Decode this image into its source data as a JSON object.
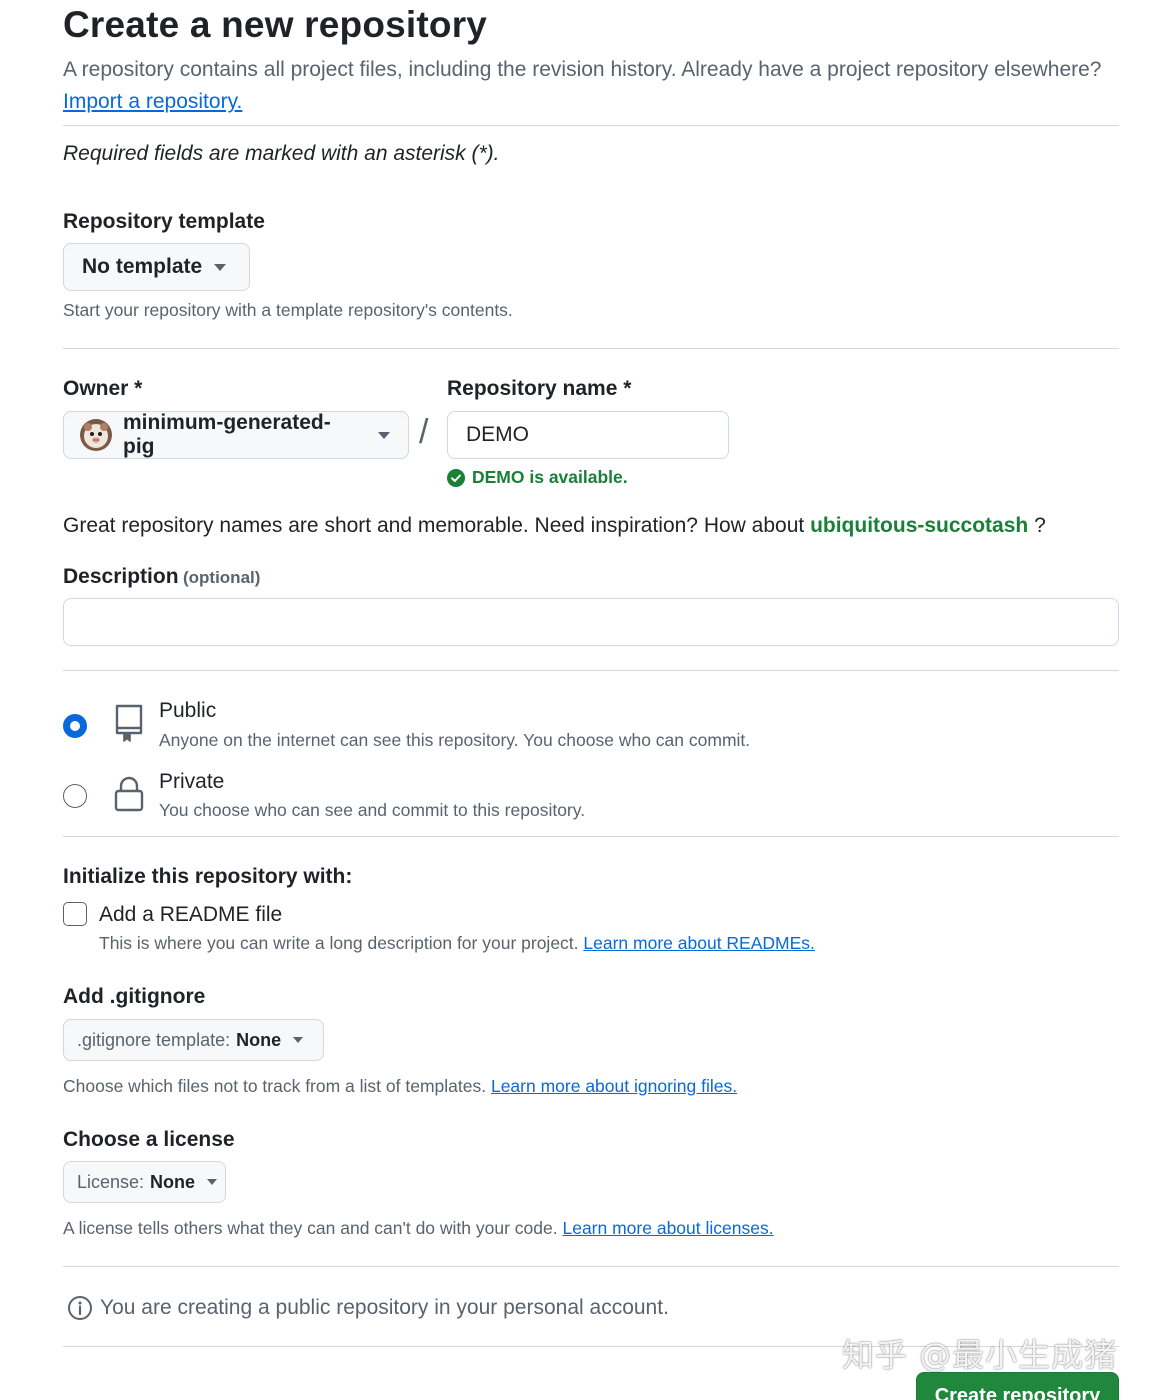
{
  "header": {
    "title": "Create a new repository",
    "subtitle": "A repository contains all project files, including the revision history. Already have a project repository elsewhere?",
    "import_link": "Import a repository."
  },
  "required_note": "Required fields are marked with an asterisk (*).",
  "template": {
    "label": "Repository template",
    "value": "No template",
    "hint": "Start your repository with a template repository's contents."
  },
  "owner": {
    "label": "Owner *",
    "value": "minimum-generated-pig"
  },
  "separator": "/",
  "repo_name": {
    "label": "Repository name *",
    "value": "DEMO",
    "status": "DEMO is available."
  },
  "inspiration": {
    "text": "Great repository names are short and memorable. Need inspiration? How about",
    "suggestion": "ubiquitous-succotash",
    "end": "?"
  },
  "description": {
    "label": "Description",
    "optional": "(optional)",
    "value": ""
  },
  "visibility": {
    "selected": "public",
    "public": {
      "title": "Public",
      "desc": "Anyone on the internet can see this repository. You choose who can commit."
    },
    "private": {
      "title": "Private",
      "desc": "You choose who can see and commit to this repository."
    }
  },
  "initialize": {
    "label": "Initialize this repository with:",
    "readme": {
      "title": "Add a README file",
      "checked": false,
      "desc": "This is where you can write a long description for your project.",
      "link": "Learn more about READMEs."
    }
  },
  "gitignore": {
    "label": "Add .gitignore",
    "prefix": ".gitignore template:",
    "value": "None",
    "hint": "Choose which files not to track from a list of templates.",
    "link": "Learn more about ignoring files."
  },
  "license": {
    "label": "Choose a license",
    "prefix": "License:",
    "value": "None",
    "hint": "A license tells others what they can and can't do with your code.",
    "link": "Learn more about licenses."
  },
  "notice": "You are creating a public repository in your personal account.",
  "submit_label": "Create repository",
  "watermark": "知乎 @最小生成猪",
  "colors": {
    "accent": "#0969da",
    "success": "#1a7f37",
    "primary_button": "#1f883d"
  }
}
